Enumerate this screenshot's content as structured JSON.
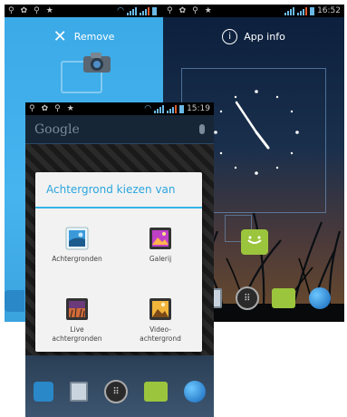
{
  "left_screen": {
    "action_label": "Remove",
    "close_glyph": "✕"
  },
  "right_screen": {
    "action_label": "App info",
    "info_glyph": "i",
    "status_time": "16:52"
  },
  "front_screen": {
    "status_time": "15:19",
    "search_placeholder": "Google"
  },
  "dialog": {
    "title": "Achtergrond kiezen van",
    "options": [
      {
        "label": "Achtergronden",
        "icon": "wallpapers-icon"
      },
      {
        "label": "Galerij",
        "icon": "gallery-icon"
      },
      {
        "label": "Live\nachtergronden",
        "icon": "live-wallpapers-icon"
      },
      {
        "label": "Video-\nachtergrond",
        "icon": "video-wallpaper-icon"
      }
    ]
  },
  "colors": {
    "accent": "#33b5e5",
    "drag_remove_blue": "#3aa9e6",
    "messaging_green": "#9bc53d"
  }
}
